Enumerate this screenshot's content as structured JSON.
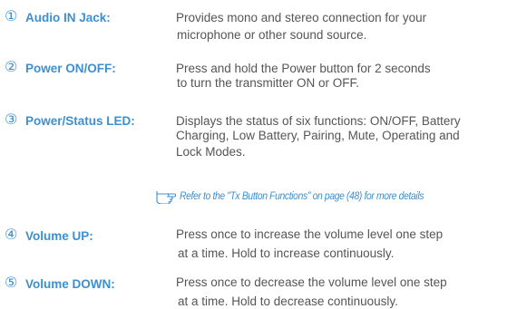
{
  "items": [
    {
      "number": "①",
      "label": "Audio IN Jack:",
      "lines": [
        "Provides mono and stereo connection for your",
        "microphone or other sound source."
      ]
    },
    {
      "number": "②",
      "label": "Power ON/OFF:",
      "lines": [
        "Press and hold the Power button for 2 seconds",
        "to turn the transmitter ON or OFF."
      ]
    },
    {
      "number": "③",
      "label": "Power/Status LED:",
      "lines": [
        "Displays the status of six functions: ON/OFF, Battery",
        "Charging, Low Battery, Pairing, Mute, Operating and",
        "Lock Modes."
      ]
    },
    {
      "number": "④",
      "label": "Volume UP:",
      "lines": [
        "Press once to increase the volume level one step",
        "at a time. Hold to increase continuously."
      ]
    },
    {
      "number": "⑤",
      "label": "Volume DOWN:",
      "lines": [
        "Press once to decrease the volume level one step",
        "at a time. Hold to decrease continuously."
      ]
    }
  ],
  "note": {
    "icon": "pointing-hand-icon",
    "text": "Refer to the \"Tx Button Functions\" on page (48) for more details"
  },
  "colors": {
    "accent": "#3c8fd0",
    "body_text": "#555555"
  }
}
